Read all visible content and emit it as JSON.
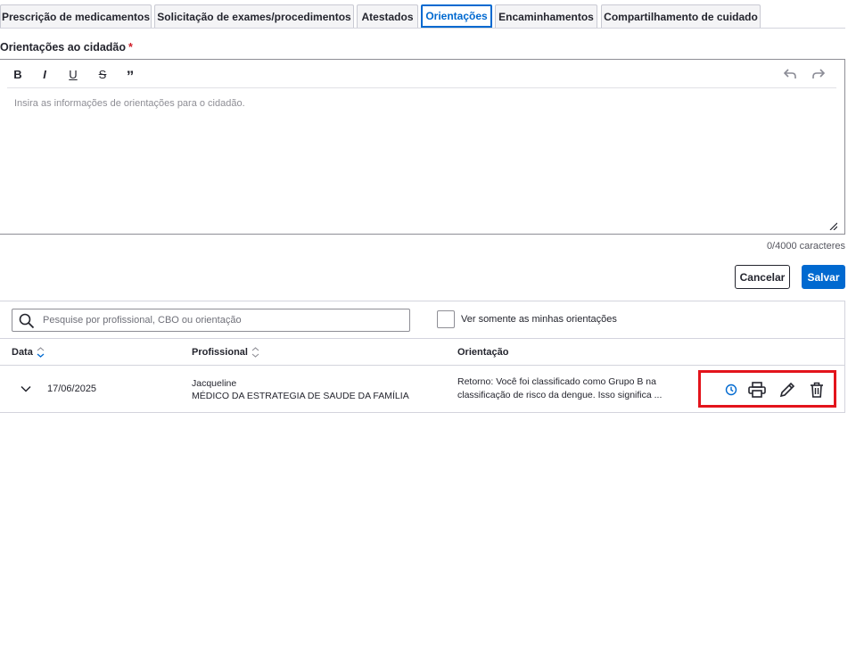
{
  "tabs": [
    {
      "label": "Prescrição de medicamentos",
      "active": false
    },
    {
      "label": "Solicitação de exames/procedimentos",
      "active": false
    },
    {
      "label": "Atestados",
      "active": false
    },
    {
      "label": "Orientações",
      "active": true
    },
    {
      "label": "Encaminhamentos",
      "active": false
    },
    {
      "label": "Compartilhamento de cuidado",
      "active": false
    }
  ],
  "form": {
    "label": "Orientações ao cidadão",
    "required_mark": "*",
    "placeholder": "Insira as informações de orientações para o cidadão.",
    "char_count": "0/4000 caracteres",
    "toolbar": {
      "bold": "B",
      "italic": "I",
      "underline": "U",
      "strike": "S",
      "quote": "”"
    },
    "cancel_label": "Cancelar",
    "save_label": "Salvar"
  },
  "list": {
    "search_placeholder": "Pesquise por profissional, CBO ou orientação",
    "filter_label": "Ver somente as minhas orientações",
    "columns": {
      "date": "Data",
      "professional": "Profissional",
      "orientation": "Orientação"
    },
    "rows": [
      {
        "date": "17/06/2025",
        "professional_name": "Jacqueline",
        "professional_cbo": "MÉDICO DA ESTRATEGIA DE SAUDE DA FAMÍLIA",
        "orientation": "Retorno: Você foi classificado como Grupo B na classificação de risco da dengue. Isso significa ..."
      }
    ]
  },
  "colors": {
    "primary": "#0069d0",
    "danger": "#d01e29",
    "highlight": "#e3141c"
  },
  "icons": [
    "undo-icon",
    "redo-icon",
    "search-icon",
    "sort-icon",
    "chevron-down-icon",
    "history-icon",
    "print-icon",
    "edit-icon",
    "trash-icon"
  ]
}
